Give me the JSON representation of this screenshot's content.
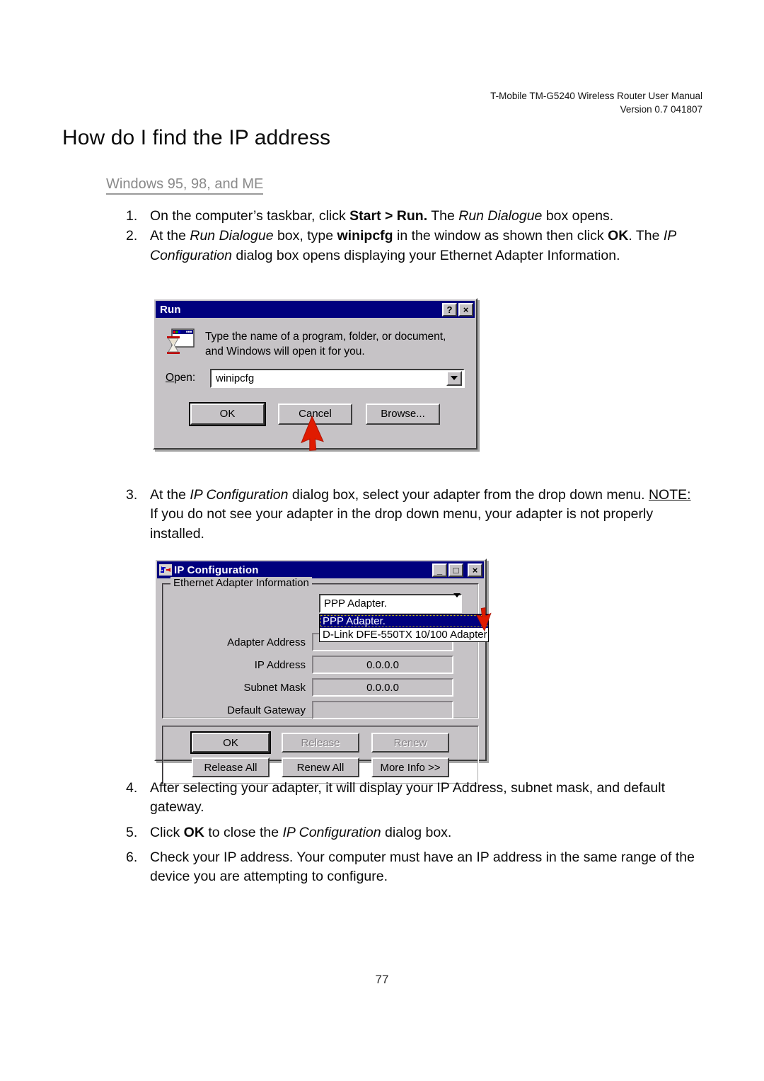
{
  "document": {
    "header_line1": "T-Mobile TM-G5240 Wireless Router User Manual",
    "header_line2": "Version 0.7 041807",
    "page_title": "How do I find the IP address",
    "section_subtitle": "Windows 95, 98, and ME",
    "page_number": "77"
  },
  "steps": {
    "step1": {
      "number": "1.",
      "parts": [
        {
          "text": "On the computer’s taskbar, click ",
          "style": "normal"
        },
        {
          "text": "Start > Run.",
          "style": "bold"
        },
        {
          "text": "  The ",
          "style": "normal"
        },
        {
          "text": "Run Dialogue",
          "style": "italic"
        },
        {
          "text": " box opens.",
          "style": "normal"
        }
      ]
    },
    "step2": {
      "number": "2.",
      "parts": [
        {
          "text": "At the ",
          "style": "normal"
        },
        {
          "text": "Run Dialogue",
          "style": "italic"
        },
        {
          "text": " box, type ",
          "style": "normal"
        },
        {
          "text": "winipcfg",
          "style": "bold"
        },
        {
          "text": " in the window as shown then click ",
          "style": "normal"
        },
        {
          "text": "OK",
          "style": "bold"
        },
        {
          "text": ". The ",
          "style": "normal"
        },
        {
          "text": "IP Configuration",
          "style": "italic"
        },
        {
          "text": " dialog box opens displaying your Ethernet Adapter Information.",
          "style": "normal"
        }
      ]
    },
    "step3": {
      "number": "3.",
      "parts": [
        {
          "text": "At the ",
          "style": "normal"
        },
        {
          "text": "IP Configuration",
          "style": "italic"
        },
        {
          "text": " dialog box, select your adapter from the drop down menu. ",
          "style": "normal"
        },
        {
          "text": "NOTE:",
          "style": "underline"
        },
        {
          "text": " If you do not see your adapter in the drop down menu, your adapter is not properly installed.",
          "style": "normal"
        }
      ]
    },
    "step4": {
      "number": "4.",
      "parts": [
        {
          "text": "After selecting your adapter, it will display your IP Address, subnet mask, and default gateway.",
          "style": "normal"
        }
      ]
    },
    "step5": {
      "number": "5.",
      "parts": [
        {
          "text": "Click ",
          "style": "normal"
        },
        {
          "text": "OK",
          "style": "bold"
        },
        {
          "text": " to close the ",
          "style": "normal"
        },
        {
          "text": "IP Configuration",
          "style": "italic"
        },
        {
          "text": " dialog box.",
          "style": "normal"
        }
      ]
    },
    "step6": {
      "number": "6.",
      "parts": [
        {
          "text": "Check your IP address. Your computer must have an IP address in the same range of the device you are attempting to configure.",
          "style": "normal"
        }
      ]
    }
  },
  "run_dialog": {
    "title": "Run",
    "help_button": "?",
    "close_button": "×",
    "icon_name": "run-program-hourglass-icon",
    "description": "Type the name of a program, folder, or document, and Windows will open it for you.",
    "open_label": "Open:",
    "open_value": "winipcfg",
    "dropdown_arrow_icon": "chevron-down-icon",
    "buttons": [
      {
        "label": "OK",
        "default": true,
        "disabled": false
      },
      {
        "label": "Cancel",
        "default": false,
        "disabled": false
      },
      {
        "label": "Browse...",
        "default": false,
        "disabled": false
      }
    ],
    "cursor_icon": "red-arrow-cursor"
  },
  "ipconfig_dialog": {
    "title": "IP Configuration",
    "icon_name": "ip-configuration-icon",
    "minimize_button": "_",
    "maximize_button": "□",
    "close_button": "×",
    "group_title": "Ethernet Adapter Information",
    "adapter_selected": "PPP Adapter.",
    "dropdown_arrow_icon": "chevron-down-icon",
    "adapter_options": [
      {
        "label": "PPP Adapter.",
        "selected": true
      },
      {
        "label": "D-Link DFE-550TX 10/100 Adapter",
        "selected": false
      }
    ],
    "fields": [
      {
        "label": "Adapter Address",
        "value": ""
      },
      {
        "label": "IP Address",
        "value": "0.0.0.0"
      },
      {
        "label": "Subnet Mask",
        "value": "0.0.0.0"
      },
      {
        "label": "Default Gateway",
        "value": ""
      }
    ],
    "buttons_row1": [
      {
        "label": "OK",
        "default": true,
        "disabled": false
      },
      {
        "label": "Release",
        "default": false,
        "disabled": true
      },
      {
        "label": "Renew",
        "default": false,
        "disabled": true
      }
    ],
    "buttons_row2": [
      {
        "label": "Release All",
        "default": false,
        "disabled": false
      },
      {
        "label": "Renew All",
        "default": false,
        "disabled": false
      },
      {
        "label": "More Info >>",
        "default": false,
        "disabled": false
      }
    ],
    "cursor_icon": "red-arrow-cursor"
  },
  "colors": {
    "titlebar_blue": "#00007e",
    "dialog_face": "#c6c3c6",
    "accent_red": "#e01b00",
    "subtitle_gray": "#8a8a8a"
  }
}
